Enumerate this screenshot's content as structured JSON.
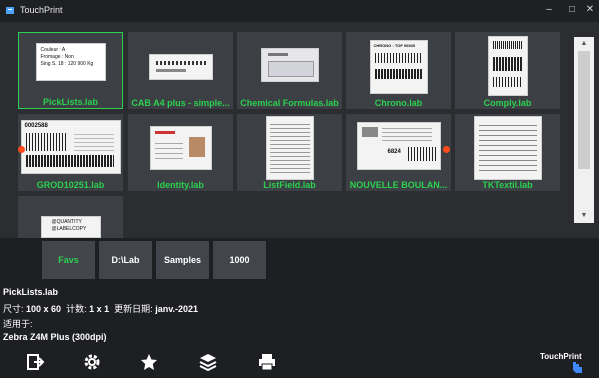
{
  "window": {
    "title": "TouchPrint"
  },
  "tiles": [
    {
      "name": "PickLists.lab",
      "selected": true,
      "lines": [
        "Couleur : A",
        "Fromage : Non",
        "Sing S. 18 : 120 900 Kg"
      ]
    },
    {
      "name": "CAB A4 plus - simple...",
      "selected": false
    },
    {
      "name": "Chemical Formulas.lab",
      "selected": false
    },
    {
      "name": "Chrono.lab",
      "selected": false,
      "lines": [
        "CHRONO : TOF 06945"
      ]
    },
    {
      "name": "Comply.lab",
      "selected": false
    },
    {
      "name": "GROD10251.lab",
      "selected": false,
      "lines": [
        "0002588"
      ]
    },
    {
      "name": "Identity.lab",
      "selected": false
    },
    {
      "name": "ListField.lab",
      "selected": false
    },
    {
      "name": "NOUVELLE BOULAN...",
      "selected": false,
      "lines": [
        "6824"
      ]
    },
    {
      "name": "TKTextil.lab",
      "selected": false
    },
    {
      "name": "",
      "selected": false,
      "lines": [
        "@QUANTITY",
        "@LABELCOPY"
      ]
    }
  ],
  "tabs": [
    {
      "label": "Favs",
      "active": true
    },
    {
      "label": "D:\\Lab",
      "active": false
    },
    {
      "label": "Samples",
      "active": false
    },
    {
      "label": "1000",
      "active": false
    }
  ],
  "info": {
    "filename": "PickLists.lab",
    "size_label": "尺寸:",
    "size_value": "100 x 60",
    "count_label": "计数:",
    "count_value": "1 x 1",
    "updated_label": "更新日期:",
    "updated_value": "janv.-2021",
    "applies_label": "适用于:",
    "printer": "Zebra Z4M Plus (300dpi)"
  },
  "toolbar": [
    "exit-icon",
    "gear-icon",
    "star-icon",
    "layers-icon",
    "printer-icon"
  ],
  "brand": "TouchPrint",
  "colors": {
    "accent": "#2bd14f",
    "marker": "#ff4a1c"
  }
}
